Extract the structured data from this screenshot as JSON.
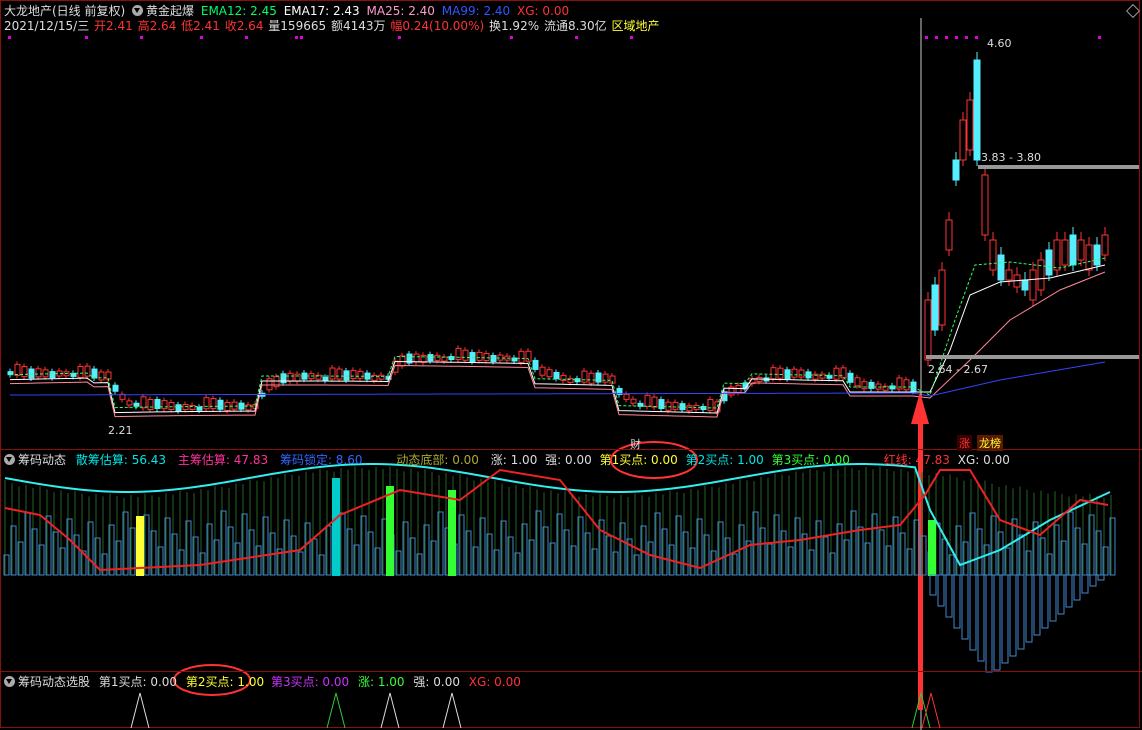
{
  "main": {
    "title": "大龙地产(日线 前复权)",
    "indicator": "黄金起爆",
    "ema12": {
      "label": "EMA12: 2.45",
      "color": "#ffffff"
    },
    "ema17": {
      "label": "EMA17: 2.43",
      "color": "#ffff00"
    },
    "ma25": {
      "label": "MA25: 2.40",
      "color": "#ff66cc"
    },
    "ma99": {
      "label": "MA99: 2.40",
      "color": "#3344ff"
    },
    "xg": {
      "label": "XG: 0.00",
      "color": "#ff3333"
    },
    "date": "2021/12/15/三",
    "open": "开2.41",
    "high": "高2.64",
    "low": "低2.41",
    "close": "收2.64",
    "volume": "量159665",
    "amount": "额4143万",
    "change": "幅0.24(10.00%)",
    "turnover": "换1.92%",
    "float": "流通8.30亿",
    "sector": "区域地产",
    "price_high_label": "4.60",
    "price_low_label": "2.21",
    "range_upper": "3.83 - 3.80",
    "range_lower": "2.64 - 2.67",
    "marker_cai": "财",
    "tag_zhang": "涨",
    "tag_longhu": "龙榜"
  },
  "panel2": {
    "title": "筹码动态",
    "sanchou": {
      "label": "散筹估算: 56.43",
      "color": "#00e5e5"
    },
    "zhuchou": {
      "label": "主筹估算: 47.83",
      "color": "#ff3399"
    },
    "suoding": {
      "label": "筹码锁定: 8.60",
      "color": "#3366ff"
    },
    "dongtai": {
      "label": "动态底部: 0.00",
      "color": "#aaaa33"
    },
    "zhang": {
      "label": "涨: 1.00",
      "color": "#dddddd"
    },
    "qiang": {
      "label": "强: 0.00",
      "color": "#dddddd"
    },
    "buy1": {
      "label": "第1买点: 0.00",
      "color": "#ffff33"
    },
    "buy2": {
      "label": "第2买点: 1.00",
      "color": "#00e5e5"
    },
    "buy3": {
      "label": "第3买点: 0.00",
      "color": "#33ff33"
    },
    "hongxian": {
      "label": "红线: 47.83",
      "color": "#ff3333"
    },
    "xg": {
      "label": "XG: 0.00",
      "color": "#dddddd"
    }
  },
  "panel3": {
    "title": "筹码动态选股",
    "buy1": {
      "label": "第1买点: 0.00",
      "color": "#dddddd"
    },
    "buy2": {
      "label": "第2买点: 1.00",
      "color": "#ffff33"
    },
    "buy3": {
      "label": "第3买点: 0.00",
      "color": "#cc33ff"
    },
    "zhang": {
      "label": "涨: 1.00",
      "color": "#33ff33"
    },
    "qiang": {
      "label": "强: 0.00",
      "color": "#dddddd"
    },
    "xg": {
      "label": "XG: 0.00",
      "color": "#ff3333"
    }
  }
}
